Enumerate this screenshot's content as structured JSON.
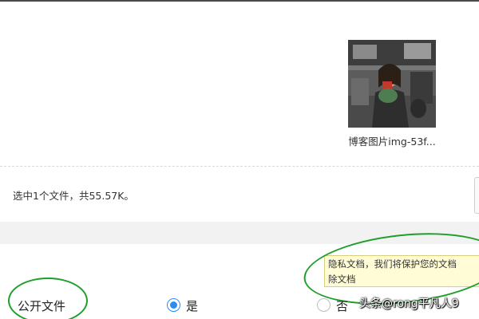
{
  "file": {
    "name": "博客图片img-53f...",
    "thumbnail_icon": "photo-thumbnail"
  },
  "status": {
    "selection_text": "选中1个文件，共55.57K。"
  },
  "privacy": {
    "tooltip_line1": "隐私文档，我们将保护您的文档",
    "tooltip_line2": "除文档",
    "field_label": "公开文件",
    "options": [
      {
        "label": "是",
        "selected": true
      },
      {
        "label": "否",
        "selected": false
      }
    ]
  },
  "watermark": "头条@rong平凡人9",
  "colors": {
    "annotation_ellipse": "#1e9e2a",
    "radio_accent": "#2d8cf0",
    "tooltip_bg": "#fffcd6"
  }
}
